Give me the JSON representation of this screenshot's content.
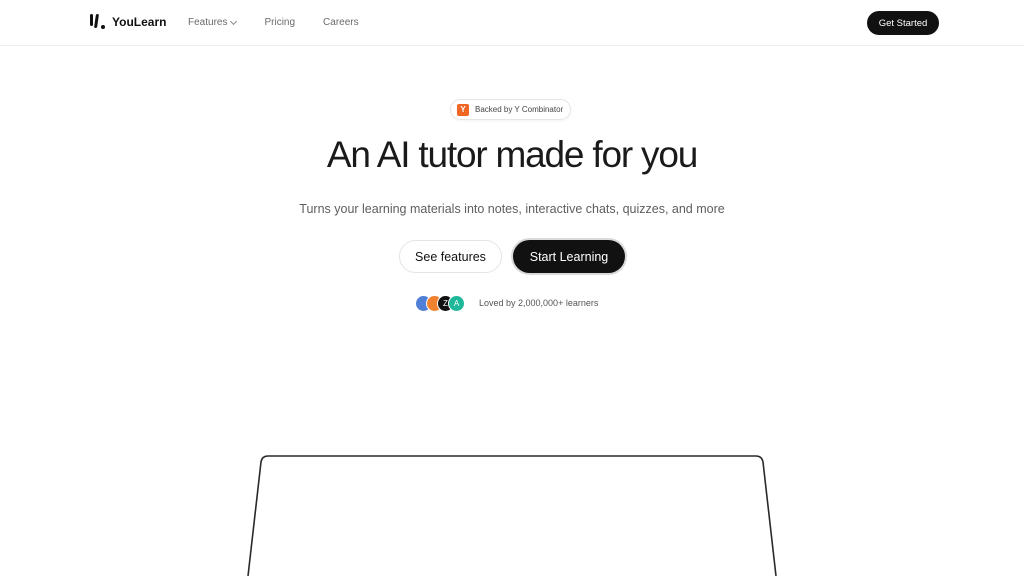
{
  "nav": {
    "brand": "YouLearn",
    "links": [
      {
        "label": "Features",
        "has_dropdown": true
      },
      {
        "label": "Pricing",
        "has_dropdown": false
      },
      {
        "label": "Careers",
        "has_dropdown": false
      }
    ],
    "cta": "Get Started"
  },
  "hero": {
    "badge_icon": "Y",
    "badge": "Backed by Y Combinator",
    "headline": "An AI tutor made for you",
    "subheadline": "Turns your learning materials into notes, interactive chats, quizzes, and more",
    "secondary_button": "See features",
    "primary_button": "Start Learning",
    "avatars": [
      {
        "initial": "",
        "color": "#4f7fd6"
      },
      {
        "initial": "",
        "color": "#f0822f"
      },
      {
        "initial": "Z",
        "color": "#111111"
      },
      {
        "initial": "A",
        "color": "#1fb89a"
      }
    ],
    "social_proof": "Loved by 2,000,000+ learners"
  },
  "colors": {
    "brand_dark": "#111111",
    "yc_orange": "#f26625"
  }
}
